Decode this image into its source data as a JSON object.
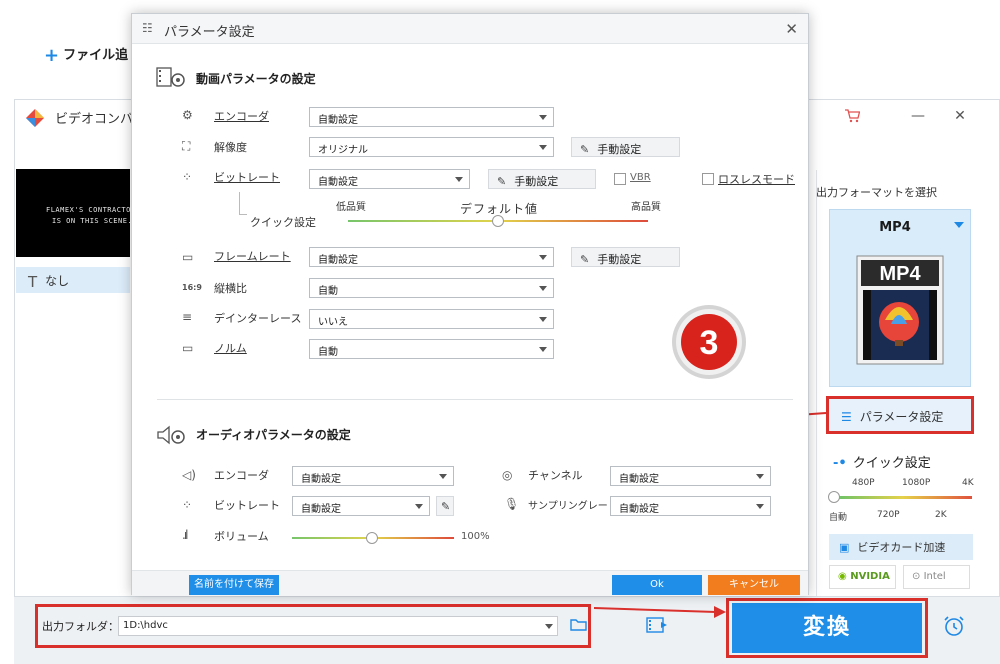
{
  "main": {
    "title": "ビデオコンバ",
    "add_file": "ファイル追",
    "thumb_line1": "FLAMEX'S CONTRACTOR",
    "thumb_line2": "IS ON THIS SCENE.",
    "subtitle_value": "なし",
    "output_format_caption": "出力フォーマットを選択",
    "format_name": "MP4",
    "format_badge": "MP4",
    "param_button": "パラメータ設定",
    "quick_setting": "クイック設定",
    "quick_labels_top": [
      "480P",
      "1080P",
      "4K"
    ],
    "quick_labels_bottom": [
      "自動",
      "720P",
      "2K"
    ],
    "gpu_button": "ビデオカード加速",
    "vendor_nvidia": "NVIDIA",
    "vendor_intel": "Intel",
    "output_folder_label": "出力フォルダ：",
    "output_folder_value": "1D:\\hdvc",
    "convert_button": "変換",
    "accent_color": "#1e8ee8",
    "highlight_color": "#d9302c"
  },
  "dialog": {
    "title": "パラメータ設定",
    "video_section": "動画パラメータの設定",
    "encoder_label": "エンコーダ",
    "encoder_value": "自動設定",
    "resolution_label": "解像度",
    "resolution_value": "オリジナル",
    "manual_setting": "手動設定",
    "bitrate_label": "ビットレート",
    "bitrate_value": "自動設定",
    "vbr_label": "VBR",
    "lossless_label": "ロスレスモード",
    "quick_label": "クイック設定",
    "quality_low": "低品質",
    "quality_default": "デフォルト値",
    "quality_high": "高品質",
    "framerate_label": "フレームレート",
    "framerate_value": "自動設定",
    "aspect_label": "縦横比",
    "aspect_value": "自動",
    "deinterlace_label": "デインターレース",
    "deinterlace_value": "いいえ",
    "norm_label": "ノルム",
    "norm_value": "自動",
    "audio_section": "オーディオパラメータの設定",
    "a_encoder_label": "エンコーダ",
    "a_encoder_value": "自動設定",
    "a_bitrate_label": "ビットレート",
    "a_bitrate_value": "自動設定",
    "channel_label": "チャンネル",
    "channel_value": "自動設定",
    "samplerate_label": "サンプリングレート",
    "samplerate_value": "自動設定",
    "volume_label": "ボリューム",
    "volume_value": "100%",
    "save_as_button": "名前を付けて保存",
    "ok_button": "Ok",
    "cancel_button": "キャンセル",
    "step_number": "3"
  }
}
